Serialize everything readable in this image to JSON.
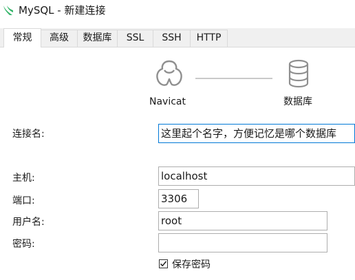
{
  "window": {
    "title": "MySQL - 新建连接",
    "app_icon": "mysql-dolphin-icon"
  },
  "tabs": [
    {
      "label": "常规",
      "active": true
    },
    {
      "label": "高级",
      "active": false
    },
    {
      "label": "数据库",
      "active": false
    },
    {
      "label": "SSL",
      "active": false
    },
    {
      "label": "SSH",
      "active": false
    },
    {
      "label": "HTTP",
      "active": false
    }
  ],
  "diagram": {
    "client_label": "Navicat",
    "client_icon": "navicat-logo-icon",
    "server_label": "数据库",
    "server_icon": "database-icon"
  },
  "form": {
    "connection_name_label": "连接名:",
    "connection_name_value": "这里起个名字，方便记忆是哪个数据库",
    "host_label": "主机:",
    "host_value": "localhost",
    "port_label": "端口:",
    "port_value": "3306",
    "username_label": "用户名:",
    "username_value": "root",
    "password_label": "密码:",
    "password_value": "",
    "save_password_label": "保存密码",
    "save_password_checked": true
  },
  "colors": {
    "focus_border": "#0078d7",
    "app_icon_green": "#35b56a"
  }
}
